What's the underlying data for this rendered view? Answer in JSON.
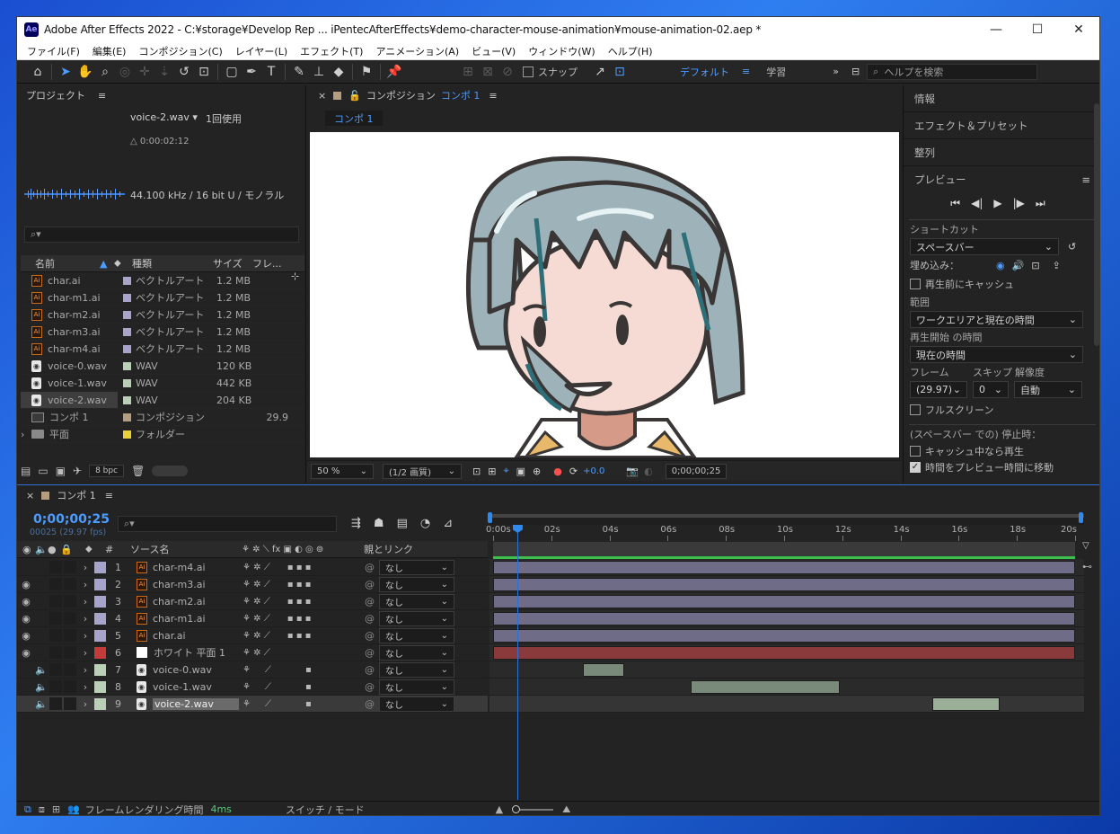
{
  "window": {
    "title": "Adobe After Effects 2022 - C:¥storage¥Develop Rep ... iPentecAfterEffects¥demo-character-mouse-animation¥mouse-animation-02.aep *",
    "app_icon": "Ae",
    "min": "—",
    "max": "☐",
    "close": "✕"
  },
  "menu": [
    "ファイル(F)",
    "編集(E)",
    "コンポジション(C)",
    "レイヤー(L)",
    "エフェクト(T)",
    "アニメーション(A)",
    "ビュー(V)",
    "ウィンドウ(W)",
    "ヘルプ(H)"
  ],
  "toolbar": {
    "snap_label": "スナップ",
    "workspace_default": "デフォルト",
    "workspace_learn": "学習",
    "help_search_placeholder": "ヘルプを検索"
  },
  "project": {
    "title": "プロジェクト",
    "selected_name": "voice-2.wav ▾",
    "usage": "1回使用",
    "duration": "△ 0:00:02:12",
    "audio_info": "44.100 kHz / 16 bit U / モノラル",
    "search_placeholder": "",
    "columns": {
      "name": "名前",
      "type": "種類",
      "size": "サイズ",
      "frame": "フレ..."
    },
    "items": [
      {
        "name": "char.ai",
        "type": "ベクトルアート",
        "size": "1.2 MB",
        "frame": "",
        "icon": "ai-file-icon",
        "swatch": "#a7a4cc"
      },
      {
        "name": "char-m1.ai",
        "type": "ベクトルアート",
        "size": "1.2 MB",
        "frame": "",
        "icon": "ai-file-icon",
        "swatch": "#a7a4cc"
      },
      {
        "name": "char-m2.ai",
        "type": "ベクトルアート",
        "size": "1.2 MB",
        "frame": "",
        "icon": "ai-file-icon",
        "swatch": "#a7a4cc"
      },
      {
        "name": "char-m3.ai",
        "type": "ベクトルアート",
        "size": "1.2 MB",
        "frame": "",
        "icon": "ai-file-icon",
        "swatch": "#a7a4cc"
      },
      {
        "name": "char-m4.ai",
        "type": "ベクトルアート",
        "size": "1.2 MB",
        "frame": "",
        "icon": "ai-file-icon",
        "swatch": "#a7a4cc"
      },
      {
        "name": "voice-0.wav",
        "type": "WAV",
        "size": "120 KB",
        "frame": "",
        "icon": "wav-file-icon",
        "swatch": "#b9cfb6"
      },
      {
        "name": "voice-1.wav",
        "type": "WAV",
        "size": "442 KB",
        "frame": "",
        "icon": "wav-file-icon",
        "swatch": "#b9cfb6"
      },
      {
        "name": "voice-2.wav",
        "type": "WAV",
        "size": "204 KB",
        "frame": "",
        "icon": "wav-file-icon",
        "swatch": "#b9cfb6"
      },
      {
        "name": "コンポ 1",
        "type": "コンポジション",
        "size": "",
        "frame": "29.9",
        "icon": "composition-icon",
        "swatch": "#b59e7f"
      },
      {
        "name": "平面",
        "type": "フォルダー",
        "size": "",
        "frame": "",
        "icon": "folder-icon",
        "swatch": "#e8d236"
      }
    ],
    "bpc": "8 bpc"
  },
  "viewer": {
    "tab_label": "コンポジション",
    "tab_comp": "コンポ 1",
    "breadcrumb": "コンポ 1",
    "zoom": "50 %",
    "resolution": "(1/2 画質)",
    "exposure": "+0.0",
    "timecode": "0;00;00;25"
  },
  "right": {
    "info": "情報",
    "effects": "エフェクト＆プリセット",
    "align": "整列",
    "preview": "プレビュー",
    "shortcut_label": "ショートカット",
    "shortcut_value": "スペースバー",
    "embed_label": "埋め込み：",
    "cache_before": "再生前にキャッシュ",
    "range_label": "範囲",
    "range_value": "ワークエリアと現在の時間",
    "playfrom_label": "再生開始 の時間",
    "playfrom_value": "現在の時間",
    "frame_label": "フレーム",
    "skip_label": "スキップ",
    "res_label": "解像度",
    "frame_value": "(29.97)",
    "skip_value": "0",
    "res_value": "自動",
    "fullscreen": "フルスクリーン",
    "stop_label": "(スペースバー での) 停止時：",
    "cache_play": "キャッシュ中なら再生",
    "move_time": "時間をプレビュー時間に移動"
  },
  "timeline": {
    "tab": "コンポ 1",
    "timecode": "0;00;00;25",
    "frame_info": "00025 (29.97 fps)",
    "search_placeholder": "",
    "col_num": "#",
    "col_source": "ソース名",
    "col_parent": "親とリンク",
    "ruler": [
      "0:00s",
      "02s",
      "04s",
      "06s",
      "08s",
      "10s",
      "12s",
      "14s",
      "16s",
      "18s",
      "20s"
    ],
    "playhead_seconds": 0.83,
    "duration_seconds": 20,
    "layers": [
      {
        "num": "1",
        "name": "char-m4.ai",
        "label_color": "#a7a4cc",
        "icon": "ai-file-icon",
        "parent": "なし",
        "eye": false,
        "audio": false,
        "bar_start": 0,
        "bar_end": 20,
        "bar_color": "#6e6c86"
      },
      {
        "num": "2",
        "name": "char-m3.ai",
        "label_color": "#a7a4cc",
        "icon": "ai-file-icon",
        "parent": "なし",
        "eye": true,
        "audio": false,
        "bar_start": 0,
        "bar_end": 20,
        "bar_color": "#6e6c86"
      },
      {
        "num": "3",
        "name": "char-m2.ai",
        "label_color": "#a7a4cc",
        "icon": "ai-file-icon",
        "parent": "なし",
        "eye": true,
        "audio": false,
        "bar_start": 0,
        "bar_end": 20,
        "bar_color": "#6e6c86"
      },
      {
        "num": "4",
        "name": "char-m1.ai",
        "label_color": "#a7a4cc",
        "icon": "ai-file-icon",
        "parent": "なし",
        "eye": true,
        "audio": false,
        "bar_start": 0,
        "bar_end": 20,
        "bar_color": "#6e6c86"
      },
      {
        "num": "5",
        "name": "char.ai",
        "label_color": "#a7a4cc",
        "icon": "ai-file-icon",
        "parent": "なし",
        "eye": true,
        "audio": false,
        "bar_start": 0,
        "bar_end": 20,
        "bar_color": "#6e6c86"
      },
      {
        "num": "6",
        "name": "ホワイト 平面 1",
        "label_color": "#c23a3a",
        "icon": "solid-icon",
        "parent": "なし",
        "eye": true,
        "audio": false,
        "bar_start": 0,
        "bar_end": 20,
        "bar_color": "#8a3a3a"
      },
      {
        "num": "7",
        "name": "voice-0.wav",
        "label_color": "#b9cfb6",
        "icon": "wav-file-icon",
        "parent": "なし",
        "eye": false,
        "audio": true,
        "bar_start": 3.1,
        "bar_end": 4.5,
        "bar_color": "#7a8a7a"
      },
      {
        "num": "8",
        "name": "voice-1.wav",
        "label_color": "#b9cfb6",
        "icon": "wav-file-icon",
        "parent": "なし",
        "eye": false,
        "audio": true,
        "bar_start": 6.8,
        "bar_end": 11.9,
        "bar_color": "#7a8a7a"
      },
      {
        "num": "9",
        "name": "voice-2.wav",
        "label_color": "#b9cfb6",
        "icon": "wav-file-icon",
        "parent": "なし",
        "eye": false,
        "audio": true,
        "bar_start": 15.1,
        "bar_end": 17.4,
        "bar_color": "#9aae98"
      }
    ],
    "status_render": "フレームレンダリング時間",
    "status_ms": "4ms",
    "status_switch": "スイッチ / モード"
  },
  "colors": {
    "accent": "#4d9cff",
    "panel": "#232323",
    "playhead": "#2f6fd6"
  }
}
